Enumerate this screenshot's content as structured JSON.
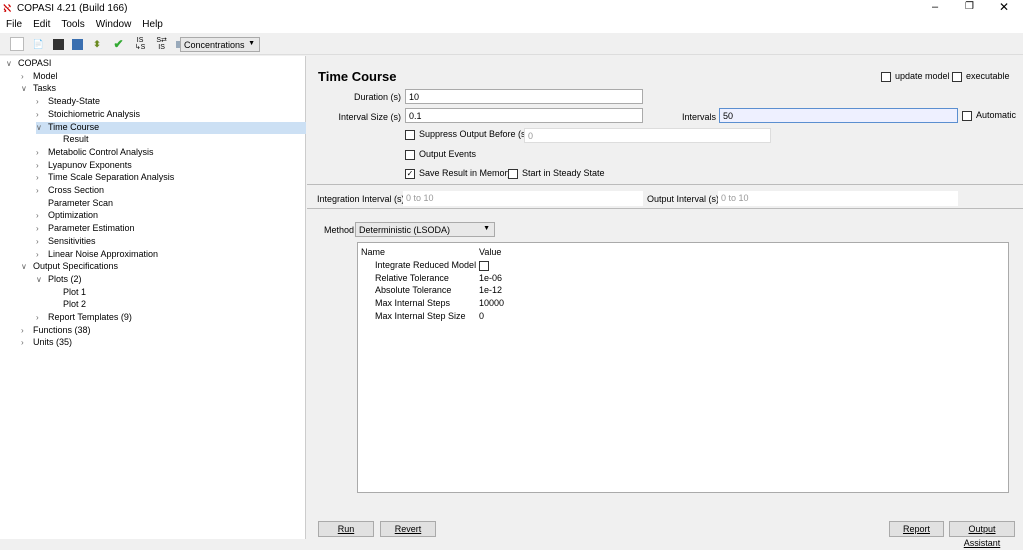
{
  "window": {
    "title": "COPASI 4.21 (Build 166)"
  },
  "menu": [
    "File",
    "Edit",
    "Tools",
    "Window",
    "Help"
  ],
  "toolbar": {
    "quantity_type": "Concentrations",
    "icons": [
      "new-icon",
      "open-icon",
      "save-icon",
      "export-icon",
      "slider-icon",
      "check-icon",
      "convert-to-irreversible-icon",
      "convert-reactions-icon",
      "parameter-overview-icon"
    ]
  },
  "tree": [
    {
      "label": "COPASI",
      "level": 0,
      "arrow": "v"
    },
    {
      "label": "Model",
      "level": 1,
      "arrow": ">"
    },
    {
      "label": "Tasks",
      "level": 1,
      "arrow": "v"
    },
    {
      "label": "Steady-State",
      "level": 2,
      "arrow": ">"
    },
    {
      "label": "Stoichiometric Analysis",
      "level": 2,
      "arrow": ">"
    },
    {
      "label": "Time Course",
      "level": 2,
      "arrow": "v",
      "selected": true
    },
    {
      "label": "Result",
      "level": 3,
      "arrow": ""
    },
    {
      "label": "Metabolic Control Analysis",
      "level": 2,
      "arrow": ">"
    },
    {
      "label": "Lyapunov Exponents",
      "level": 2,
      "arrow": ">"
    },
    {
      "label": "Time Scale Separation Analysis",
      "level": 2,
      "arrow": ">"
    },
    {
      "label": "Cross Section",
      "level": 2,
      "arrow": ">"
    },
    {
      "label": "Parameter Scan",
      "level": 2,
      "arrow": ""
    },
    {
      "label": "Optimization",
      "level": 2,
      "arrow": ">"
    },
    {
      "label": "Parameter Estimation",
      "level": 2,
      "arrow": ">"
    },
    {
      "label": "Sensitivities",
      "level": 2,
      "arrow": ">"
    },
    {
      "label": "Linear Noise Approximation",
      "level": 2,
      "arrow": ">"
    },
    {
      "label": "Output Specifications",
      "level": 1,
      "arrow": "v"
    },
    {
      "label": "Plots (2)",
      "level": 2,
      "arrow": "v"
    },
    {
      "label": "Plot 1",
      "level": 3,
      "arrow": ""
    },
    {
      "label": "Plot 2",
      "level": 3,
      "arrow": ""
    },
    {
      "label": "Report Templates (9)",
      "level": 2,
      "arrow": ">"
    },
    {
      "label": "Functions (38)",
      "level": 1,
      "arrow": ">"
    },
    {
      "label": "Units (35)",
      "level": 1,
      "arrow": ">"
    }
  ],
  "task": {
    "title": "Time Course",
    "update_model": {
      "label": "update model",
      "checked": false
    },
    "executable": {
      "label": "executable",
      "checked": false
    },
    "duration_label": "Duration (s)",
    "duration": "10",
    "interval_size_label": "Interval Size (s)",
    "interval_size": "0.1",
    "intervals_label": "Intervals",
    "intervals": "50",
    "automatic": {
      "label": "Automatic",
      "checked": false
    },
    "suppress": {
      "label": "Suppress Output Before (s)",
      "checked": false,
      "value": "0"
    },
    "output_events": {
      "label": "Output Events",
      "checked": false
    },
    "save_memory": {
      "label": "Save Result in Memory",
      "checked": true
    },
    "steady_state": {
      "label": "Start in Steady State",
      "checked": false
    },
    "integration_interval_label": "Integration Interval (s)",
    "integration_interval": "0 to 10",
    "output_interval_label": "Output Interval (s)",
    "output_interval": "0 to 10",
    "method_label": "Method",
    "method": "Deterministic (LSODA)",
    "table_headers": [
      "Name",
      "Value"
    ],
    "params": [
      {
        "name": "Integrate Reduced Model",
        "value": "",
        "checkbox": true
      },
      {
        "name": "Relative Tolerance",
        "value": "1e-06"
      },
      {
        "name": "Absolute Tolerance",
        "value": "1e-12"
      },
      {
        "name": "Max Internal Steps",
        "value": "10000"
      },
      {
        "name": "Max Internal Step Size",
        "value": "0"
      }
    ],
    "buttons": {
      "run": "Run",
      "revert": "Revert",
      "report": "Report",
      "assistant": "Output Assistant"
    }
  }
}
